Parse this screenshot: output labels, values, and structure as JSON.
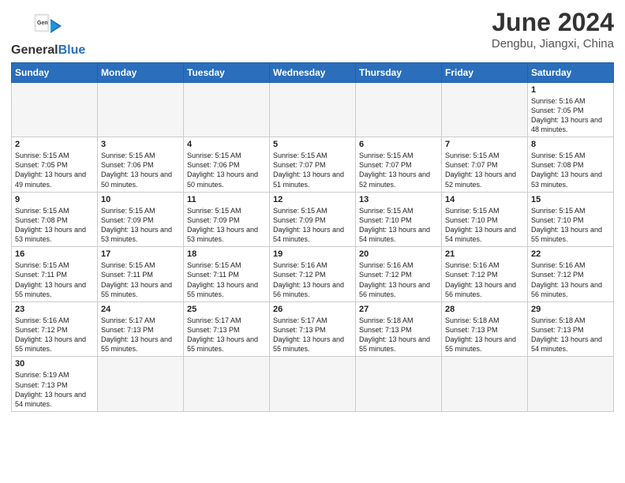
{
  "header": {
    "logo_text_regular": "General",
    "logo_text_blue": "Blue",
    "month_title": "June 2024",
    "location": "Dengbu, Jiangxi, China"
  },
  "weekdays": [
    "Sunday",
    "Monday",
    "Tuesday",
    "Wednesday",
    "Thursday",
    "Friday",
    "Saturday"
  ],
  "days": [
    {
      "day": "",
      "sunrise": "",
      "sunset": "",
      "daylight": ""
    },
    {
      "day": "",
      "sunrise": "",
      "sunset": "",
      "daylight": ""
    },
    {
      "day": "",
      "sunrise": "",
      "sunset": "",
      "daylight": ""
    },
    {
      "day": "",
      "sunrise": "",
      "sunset": "",
      "daylight": ""
    },
    {
      "day": "",
      "sunrise": "",
      "sunset": "",
      "daylight": ""
    },
    {
      "day": "",
      "sunrise": "",
      "sunset": "",
      "daylight": ""
    },
    {
      "day": "1",
      "sunrise": "5:16 AM",
      "sunset": "7:05 PM",
      "daylight": "13 hours and 48 minutes."
    },
    {
      "day": "2",
      "sunrise": "5:15 AM",
      "sunset": "7:05 PM",
      "daylight": "13 hours and 49 minutes."
    },
    {
      "day": "3",
      "sunrise": "5:15 AM",
      "sunset": "7:06 PM",
      "daylight": "13 hours and 50 minutes."
    },
    {
      "day": "4",
      "sunrise": "5:15 AM",
      "sunset": "7:06 PM",
      "daylight": "13 hours and 50 minutes."
    },
    {
      "day": "5",
      "sunrise": "5:15 AM",
      "sunset": "7:07 PM",
      "daylight": "13 hours and 51 minutes."
    },
    {
      "day": "6",
      "sunrise": "5:15 AM",
      "sunset": "7:07 PM",
      "daylight": "13 hours and 52 minutes."
    },
    {
      "day": "7",
      "sunrise": "5:15 AM",
      "sunset": "7:07 PM",
      "daylight": "13 hours and 52 minutes."
    },
    {
      "day": "8",
      "sunrise": "5:15 AM",
      "sunset": "7:08 PM",
      "daylight": "13 hours and 53 minutes."
    },
    {
      "day": "9",
      "sunrise": "5:15 AM",
      "sunset": "7:08 PM",
      "daylight": "13 hours and 53 minutes."
    },
    {
      "day": "10",
      "sunrise": "5:15 AM",
      "sunset": "7:09 PM",
      "daylight": "13 hours and 53 minutes."
    },
    {
      "day": "11",
      "sunrise": "5:15 AM",
      "sunset": "7:09 PM",
      "daylight": "13 hours and 53 minutes."
    },
    {
      "day": "12",
      "sunrise": "5:15 AM",
      "sunset": "7:09 PM",
      "daylight": "13 hours and 54 minutes."
    },
    {
      "day": "13",
      "sunrise": "5:15 AM",
      "sunset": "7:10 PM",
      "daylight": "13 hours and 54 minutes."
    },
    {
      "day": "14",
      "sunrise": "5:15 AM",
      "sunset": "7:10 PM",
      "daylight": "13 hours and 54 minutes."
    },
    {
      "day": "15",
      "sunrise": "5:15 AM",
      "sunset": "7:10 PM",
      "daylight": "13 hours and 55 minutes."
    },
    {
      "day": "16",
      "sunrise": "5:15 AM",
      "sunset": "7:11 PM",
      "daylight": "13 hours and 55 minutes."
    },
    {
      "day": "17",
      "sunrise": "5:15 AM",
      "sunset": "7:11 PM",
      "daylight": "13 hours and 55 minutes."
    },
    {
      "day": "18",
      "sunrise": "5:15 AM",
      "sunset": "7:11 PM",
      "daylight": "13 hours and 55 minutes."
    },
    {
      "day": "19",
      "sunrise": "5:16 AM",
      "sunset": "7:12 PM",
      "daylight": "13 hours and 56 minutes."
    },
    {
      "day": "20",
      "sunrise": "5:16 AM",
      "sunset": "7:12 PM",
      "daylight": "13 hours and 56 minutes."
    },
    {
      "day": "21",
      "sunrise": "5:16 AM",
      "sunset": "7:12 PM",
      "daylight": "13 hours and 56 minutes."
    },
    {
      "day": "22",
      "sunrise": "5:16 AM",
      "sunset": "7:12 PM",
      "daylight": "13 hours and 56 minutes."
    },
    {
      "day": "23",
      "sunrise": "5:16 AM",
      "sunset": "7:12 PM",
      "daylight": "13 hours and 55 minutes."
    },
    {
      "day": "24",
      "sunrise": "5:17 AM",
      "sunset": "7:13 PM",
      "daylight": "13 hours and 55 minutes."
    },
    {
      "day": "25",
      "sunrise": "5:17 AM",
      "sunset": "7:13 PM",
      "daylight": "13 hours and 55 minutes."
    },
    {
      "day": "26",
      "sunrise": "5:17 AM",
      "sunset": "7:13 PM",
      "daylight": "13 hours and 55 minutes."
    },
    {
      "day": "27",
      "sunrise": "5:18 AM",
      "sunset": "7:13 PM",
      "daylight": "13 hours and 55 minutes."
    },
    {
      "day": "28",
      "sunrise": "5:18 AM",
      "sunset": "7:13 PM",
      "daylight": "13 hours and 55 minutes."
    },
    {
      "day": "29",
      "sunrise": "5:18 AM",
      "sunset": "7:13 PM",
      "daylight": "13 hours and 54 minutes."
    },
    {
      "day": "30",
      "sunrise": "5:19 AM",
      "sunset": "7:13 PM",
      "daylight": "13 hours and 54 minutes."
    }
  ],
  "labels": {
    "sunrise": "Sunrise:",
    "sunset": "Sunset:",
    "daylight": "Daylight:"
  }
}
